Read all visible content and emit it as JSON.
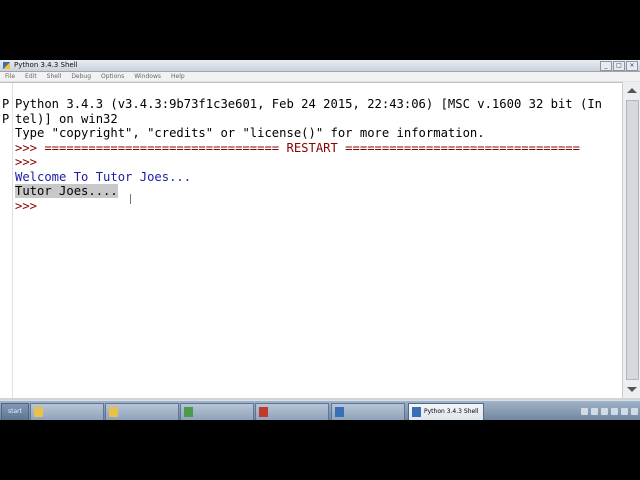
{
  "window": {
    "title": "Python 3.4.3 Shell",
    "menus": [
      "File",
      "Edit",
      "Shell",
      "Debug",
      "Options",
      "Windows",
      "Help"
    ]
  },
  "shell": {
    "gutter": [
      "P",
      "P"
    ],
    "lines": [
      {
        "text": "Python 3.4.3 (v3.4.3:9b73f1c3e601, Feb 24 2015, 22:43:06) [MSC v.1600 32 bit (In",
        "style": "out-black"
      },
      {
        "text": "tel)] on win32",
        "style": "out-black"
      },
      {
        "text": "Type \"copyright\", \"credits\" or \"license()\" for more information.",
        "style": "out-black"
      },
      {
        "text": ">>> ================================ RESTART ================================",
        "style": "prompt"
      },
      {
        "text": ">>>",
        "style": "prompt"
      },
      {
        "text": "Welcome To Tutor Joes...",
        "style": "stdout"
      },
      {
        "text": "Tutor Joes....",
        "style": "stdin-sel"
      },
      {
        "text": ">>>",
        "style": "prompt"
      }
    ]
  },
  "taskbar": {
    "start_label": "start",
    "tasks": [
      {
        "label": "",
        "icon_color": "#e8c14a"
      },
      {
        "label": "",
        "icon_color": "#e8c14a"
      },
      {
        "label": "",
        "icon_color": "#4c9a4c"
      },
      {
        "label": "",
        "icon_color": "#c0392b"
      },
      {
        "label": "",
        "icon_color": "#3a6fb5"
      },
      {
        "label": "Python 3.4.3 Shell",
        "icon_color": "#3a6fb5",
        "active": true
      }
    ]
  },
  "colors": {
    "prompt": "#8b0000",
    "stdout": "#1c1ca8",
    "selection": "#c8c8c8"
  }
}
